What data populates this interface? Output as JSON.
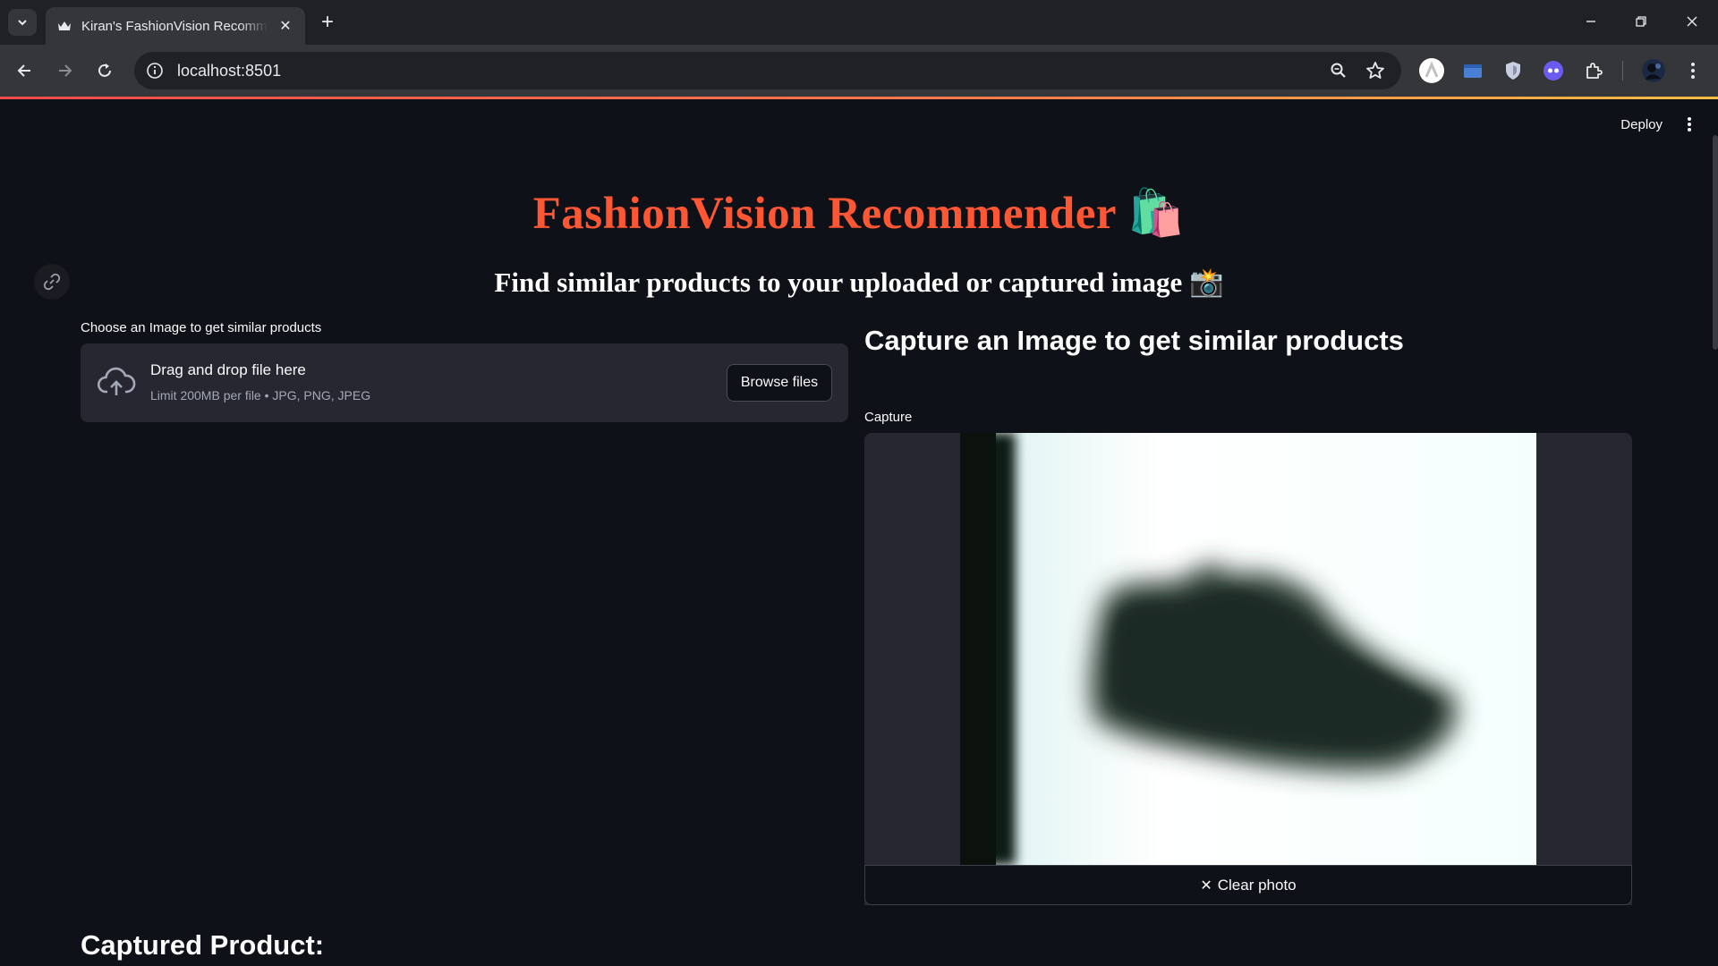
{
  "browser": {
    "tab_title": "Kiran's FashionVision Recommender",
    "url": "localhost:8501"
  },
  "app": {
    "deploy_label": "Deploy",
    "title": "FashionVision Recommender",
    "title_emoji": "🛍️",
    "subtitle": "Find similar products to your uploaded or captured image",
    "subtitle_emoji": "📸",
    "uploader": {
      "label": "Choose an Image to get similar products",
      "drop_title": "Drag and drop file here",
      "drop_hint": "Limit 200MB per file • JPG, PNG, JPEG",
      "browse_label": "Browse files"
    },
    "camera": {
      "heading": "Capture an Image to get similar products",
      "label": "Capture",
      "clear_label": "Clear photo"
    },
    "captured_heading": "Captured Product:"
  },
  "colors": {
    "title": "#ff5733",
    "background": "#0e1117",
    "widget_bg": "#262730"
  },
  "icons": {
    "tab_search": "chevron-down-icon",
    "favicon": "crown-icon",
    "link": "link-icon",
    "upload": "cloud-upload-icon"
  }
}
